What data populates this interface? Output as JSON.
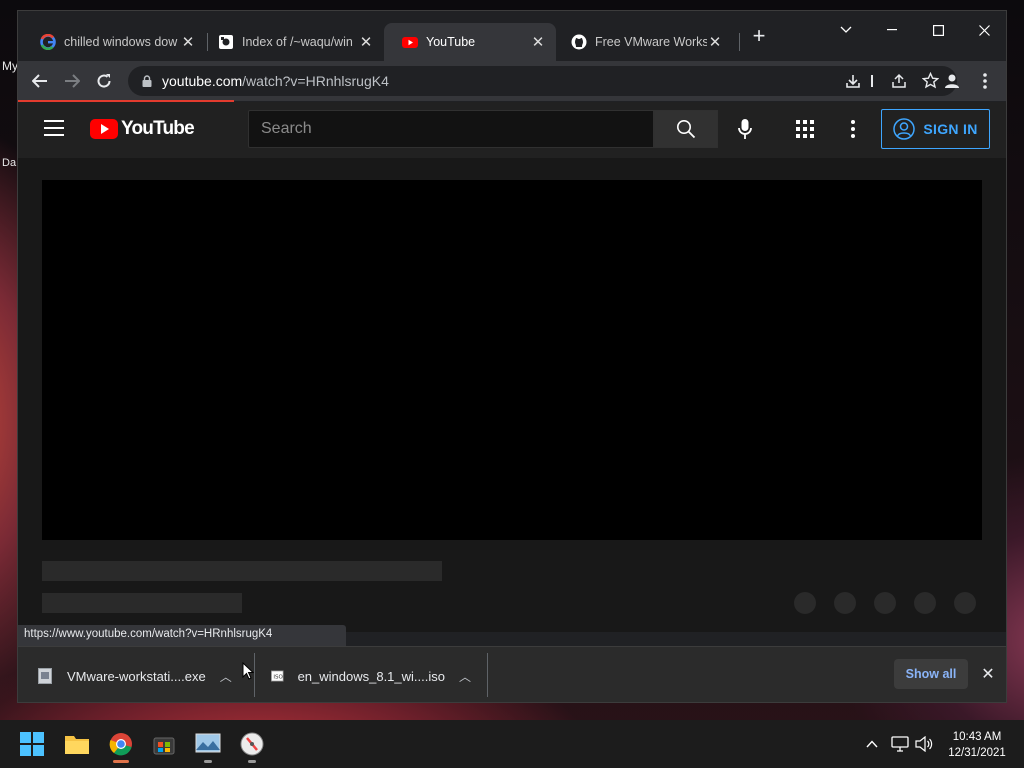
{
  "desktop": {
    "icon_labels": [
      "My",
      "Da"
    ]
  },
  "browser": {
    "tabs": [
      {
        "title": "chilled windows dow",
        "favicon": "google-icon",
        "active": false
      },
      {
        "title": "Index of /~waqu/win",
        "favicon": "index-icon",
        "active": false
      },
      {
        "title": "YouTube",
        "favicon": "youtube-icon",
        "active": true
      },
      {
        "title": "Free VMware Workst",
        "favicon": "github-icon",
        "active": false
      }
    ],
    "new_tab_label": "+",
    "address": {
      "host": "youtube.com",
      "path": "/watch?v=HRnhlsrugK4"
    },
    "status_url": "https://www.youtube.com/watch?v=HRnhlsrugK4"
  },
  "youtube": {
    "logo_text": "YouTube",
    "search_placeholder": "Search",
    "signin_label": "SIGN IN",
    "accent_color": "#3ea6ff"
  },
  "downloads": {
    "items": [
      {
        "name": "VMware-workstati....exe",
        "icon": "exe-file-icon"
      },
      {
        "name": "en_windows_8.1_wi....iso",
        "icon": "iso-file-icon"
      }
    ],
    "show_all_label": "Show all"
  },
  "taskbar": {
    "time": "10:43 AM",
    "date": "12/31/2021"
  }
}
